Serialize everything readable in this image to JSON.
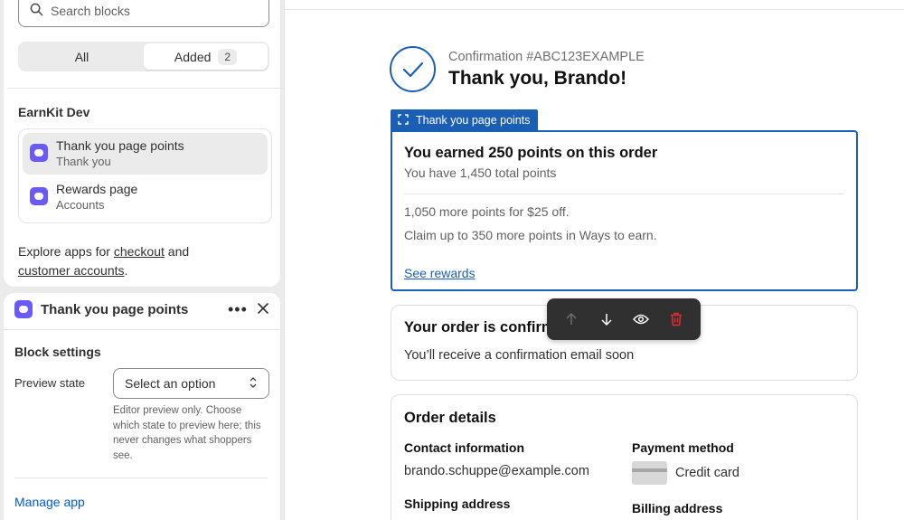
{
  "sidebar": {
    "search_placeholder": "Search blocks",
    "segments": [
      {
        "label": "All"
      },
      {
        "label": "Added",
        "count": "2"
      }
    ],
    "section_title": "EarnKit Dev",
    "apps": [
      {
        "title": "Thank you page points",
        "subtitle": "Thank you"
      },
      {
        "title": "Rewards page",
        "subtitle": "Accounts"
      }
    ],
    "explore": {
      "prefix": "Explore apps for ",
      "link1": "checkout",
      "middle": " and",
      "link2": "customer accounts",
      "suffix": "."
    }
  },
  "settings_panel": {
    "title": "Thank you page points",
    "more_label": "•••",
    "section_title": "Block settings",
    "preview_state_label": "Preview state",
    "select_value": "Select an option",
    "help_text": "Editor preview only. Choose which state to preview here; this never changes what shoppers see.",
    "manage_link": "Manage app"
  },
  "preview": {
    "confirmation_number": "Confirmation #ABC123EXAMPLE",
    "thanks": "Thank you, Brando!",
    "block_tag": "Thank you page points",
    "points": {
      "heading": "You earned 250 points on this order",
      "total": "You have 1,450 total points",
      "line1": "1,050 more points for $25 off.",
      "line2": "Claim up to 350 more points in Ways to earn.",
      "link": "See rewards"
    },
    "order_status": {
      "title": "Your order is confirmed",
      "text": "You’ll receive a confirmation email soon"
    },
    "details": {
      "title": "Order details",
      "contact_label": "Contact information",
      "contact_value": "brando.schuppe@example.com",
      "payment_label": "Payment method",
      "payment_value": "Credit card",
      "shipping_label": "Shipping address",
      "billing_label": "Billing address"
    }
  },
  "colors": {
    "accent": "#1a5fb4",
    "app_icon": "#6a5af9",
    "delete": "#e22c2c"
  },
  "icons": [
    "search-icon",
    "app-icon",
    "close-icon",
    "checkmark-icon",
    "block-select-icon",
    "arrow-up-icon",
    "arrow-down-icon",
    "eye-icon",
    "trash-icon",
    "chevron-updown-icon",
    "credit-card-icon"
  ]
}
